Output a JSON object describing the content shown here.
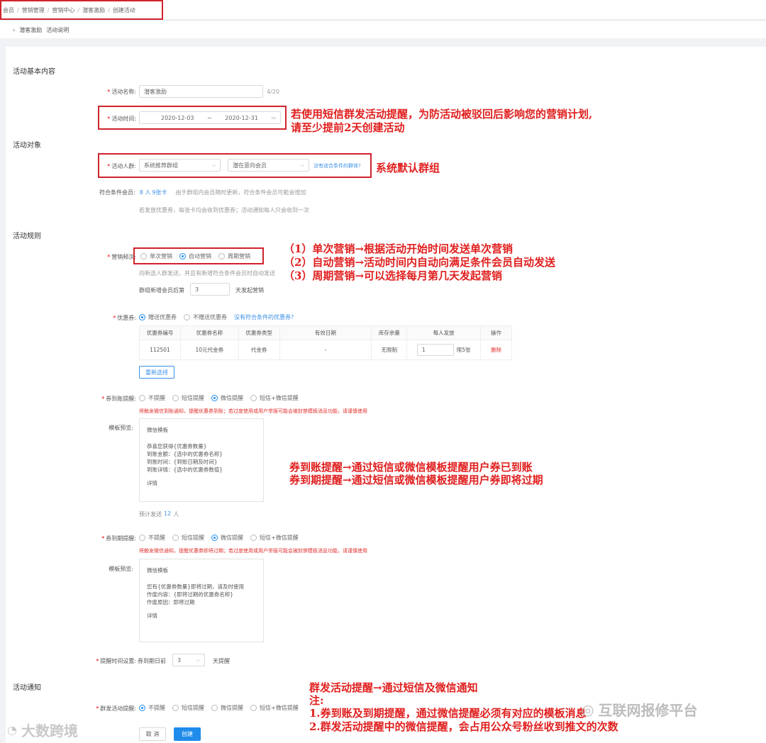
{
  "breadcrumb": [
    "会员",
    "营销管理",
    "营销中心",
    "潜客激励",
    "创建活动"
  ],
  "sub_header": {
    "chevron": "›",
    "name": "潜客激励",
    "desc": "活动说明"
  },
  "sections": {
    "basic": "活动基本内容",
    "target": "活动对象",
    "rules": "活动规则",
    "notify": "活动通知"
  },
  "activity_name": {
    "label": "活动名称:",
    "value": "潜客激励",
    "count": "4/20"
  },
  "activity_time": {
    "label": "活动时间:",
    "start": "2020-12-03",
    "sep": "~",
    "end": "2020-12-31"
  },
  "crowd": {
    "label": "活动人群:",
    "select1": "系统推荐群组",
    "select2": "潜在意向会员",
    "link": "没有适合条件的群体?"
  },
  "eligible": {
    "label": "符合条件会员:",
    "count": "8 人",
    "cards": "9张卡",
    "note": "由于群组内会员随时更新，符合条件会员可能会增加",
    "note2": "若发放优惠券，每张卡均会收到优惠券；活动通知每人只会收到一次"
  },
  "times": {
    "label": "营销频次:",
    "options": [
      "单次营销",
      "自动营销",
      "周期营销"
    ],
    "selected": 1,
    "desc": "向新选人群发送，并且有新增符合条件会员时自动发送",
    "join_label": "群组新增会员后第",
    "join_value": "3",
    "join_suffix": "天发起营销"
  },
  "coupon": {
    "label": "优惠券:",
    "options": [
      "赠送优惠券",
      "不赠送优惠券"
    ],
    "selected": 0,
    "link": "没有符合条件的优惠券?",
    "headers": [
      "优惠券编号",
      "优惠券名称",
      "优惠券类型",
      "有效日期",
      "库存余量",
      "每人发放",
      "操作"
    ],
    "row": {
      "id": "112501",
      "name": "10元代金券",
      "type": "代金券",
      "date": "-",
      "stock": "无限制",
      "per": "1",
      "limit": "限5张",
      "action": "删除"
    },
    "reselect": "重新选择"
  },
  "arrival": {
    "label": "券到账提醒:",
    "options": [
      "不提醒",
      "短信提醒",
      "微信提醒",
      "短信+微信提醒"
    ],
    "selected": 2,
    "warn": "将触发微信到账通知，提醒优惠券到账；若过度使用或用户举报可能会被封禁模板消息功能，请谨慎使用",
    "preview_label": "模板预览:",
    "tpl_title": "微信模板",
    "tpl_lines": [
      "恭喜您获得{优惠券数量}",
      "到账金额：{选中的优惠券名称}",
      "到账时间：{到账日期及时间}",
      "到账详情：{选中的优惠券数值}"
    ],
    "tpl_detail": "详情",
    "estimate_prefix": "预计发送",
    "estimate_count": "12",
    "estimate_suffix": "人"
  },
  "expire": {
    "label": "券到期提醒:",
    "options": [
      "不提醒",
      "短信提醒",
      "微信提醒",
      "短信+微信提醒"
    ],
    "selected": 2,
    "warn": "将触发微信通知，提醒优惠券即将过期；若过度使用或用户举报可能会被封禁模板消息功能，请谨慎使用",
    "preview_label": "模板预览:",
    "tpl_title": "微信模板",
    "tpl_lines": [
      "您有{优惠券数量}即将过期，请及时使用",
      "作废内容：{即将过期的优惠券名称}",
      "作废原因：即将过期"
    ],
    "tpl_detail": "详情"
  },
  "remind_time": {
    "label": "提醒时间设置:",
    "prefix": "券到期日前",
    "value": "3",
    "suffix": "天提醒"
  },
  "group_notice": {
    "label": "群发活动提醒:",
    "options": [
      "不提醒",
      "短信提醒",
      "微信提醒",
      "短信+微信提醒"
    ],
    "selected": 0
  },
  "footer": {
    "cancel": "取 消",
    "create": "创建"
  },
  "annotations": {
    "time_note_1": "若使用短信群发活动提醒，为防活动被驳回后影响您的营销计划,",
    "time_note_2": "请至少提前2天创建活动",
    "crowd_note": "系统默认群组",
    "times_note_1": "（1）单次营销→根据活动开始时间发送单次营销",
    "times_note_2": "（2）自动营销→活动时间内自动向满足条件会员自动发送",
    "times_note_3": "（3）周期营销→可以选择每月第几天发起营销",
    "coupon_note_1": "券到账提醒→通过短信或微信模板提醒用户券已到账",
    "coupon_note_2": "券到期提醒→通过短信或微信模板提醒用户券即将过期",
    "notify_note_1": "群发活动提醒→通过短信及微信通知",
    "notify_note_2": "注:",
    "notify_note_3": "1.券到账及到期提醒，通过微信提醒必须有对应的模板消息",
    "notify_note_4": "2.群发活动提醒中的微信提醒，会占用公众号粉丝收到推文的次数"
  },
  "watermarks": {
    "left": "大数跨境",
    "right": "互联网报修平台"
  },
  "colors": {
    "accent": "#1f8ceb",
    "annotation": "#e0201f",
    "required": "#e00000"
  }
}
